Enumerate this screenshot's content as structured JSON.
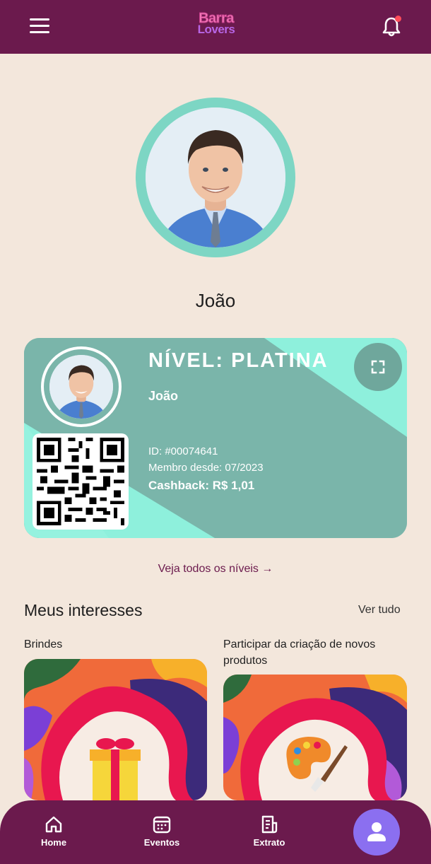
{
  "header": {
    "logo_line1": "Barra",
    "logo_line2": "Lovers",
    "menu_icon": "hamburger-icon",
    "bell_icon": "bell-icon"
  },
  "profile": {
    "name": "João"
  },
  "member_card": {
    "level": "NÍVEL: PLATINA",
    "name": "João",
    "id": "ID: #00074641",
    "member_since": "Membro desde: 07/2023",
    "cashback": "Cashback: R$ 1,01",
    "expand_icon": "expand-icon"
  },
  "links": {
    "all_levels": "Veja todos os níveis →"
  },
  "interests": {
    "title": "Meus interesses",
    "see_all": "Ver tudo",
    "items": [
      {
        "label": "Brindes",
        "icon": "gift-icon"
      },
      {
        "label": "Participar da criação de novos produtos",
        "icon": "palette-icon"
      }
    ]
  },
  "bottom_nav": {
    "items": [
      {
        "label": "Home",
        "icon": "home-icon"
      },
      {
        "label": "Eventos",
        "icon": "calendar-icon"
      },
      {
        "label": "Extrato",
        "icon": "statement-icon"
      }
    ],
    "profile_icon": "user-icon"
  },
  "colors": {
    "primary": "#6b1a4d",
    "background": "#f3e7dc",
    "card": "#7ab5aa",
    "accent": "#8ef0dc",
    "profile_button": "#8b6ff0"
  }
}
